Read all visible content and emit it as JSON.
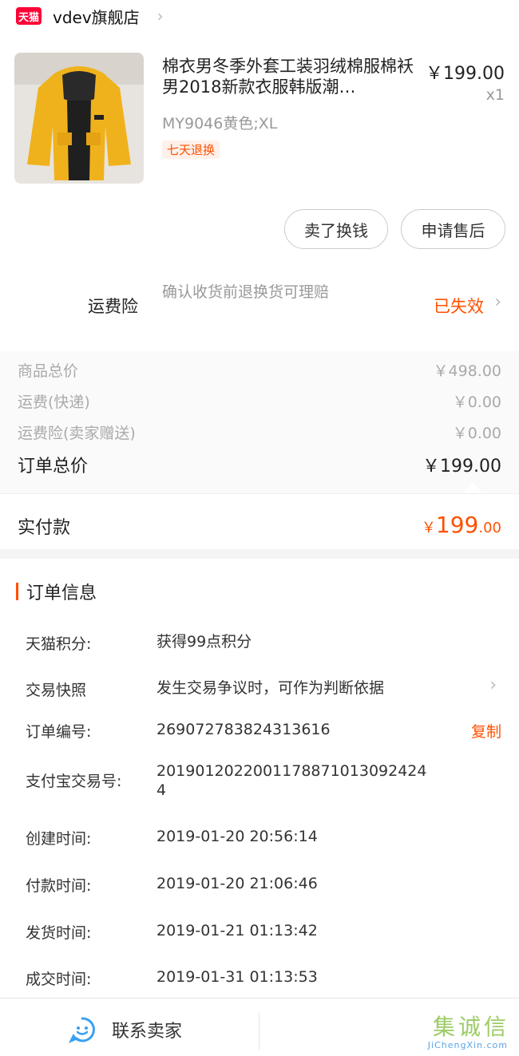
{
  "store": {
    "badge": "天猫",
    "name": "vdev旗舰店"
  },
  "product": {
    "title": "棉衣男冬季外套工装羽绒棉服棉袄男2018新款衣服韩版潮…",
    "price": "￥199.00",
    "qty": "x1",
    "sku": "MY9046黄色;XL",
    "tag": "七天退换"
  },
  "actions": {
    "sell": "卖了换钱",
    "aftersale": "申请售后"
  },
  "insurance": {
    "label": "运费险",
    "desc": "确认收货前退换货可理赔",
    "status": "已失效"
  },
  "prices": {
    "goods_label": "商品总价",
    "goods_value": "￥498.00",
    "shipping_label": "运费(快递)",
    "shipping_value": "￥0.00",
    "ins_label": "运费险(卖家赠送)",
    "ins_value": "￥0.00",
    "total_label": "订单总价",
    "total_value": "￥199.00"
  },
  "paid": {
    "label": "实付款",
    "currency": "￥",
    "integer": "199",
    "decimal": ".00"
  },
  "order_info": {
    "title": "订单信息",
    "points_key": "天猫积分:",
    "points_val": "获得99点积分",
    "snapshot_key": "交易快照",
    "snapshot_val": "发生交易争议时，可作为判断依据",
    "order_no_key": "订单编号:",
    "order_no_val": "269072783824313616",
    "copy": "复制",
    "alipay_key": "支付宝交易号:",
    "alipay_val": "20190120220011788710130924244",
    "created_key": "创建时间:",
    "created_val": "2019-01-20 20:56:14",
    "paid_key": "付款时间:",
    "paid_val": "2019-01-20 21:06:46",
    "shipped_key": "发货时间:",
    "shipped_val": "2019-01-21 01:13:42",
    "done_key": "成交时间:",
    "done_val": "2019-01-31 01:13:53"
  },
  "bottom": {
    "contact": "联系卖家"
  },
  "watermark": {
    "cn": "集诚信",
    "en": "JiChengXin.com"
  },
  "colors": {
    "accent": "#ff5000",
    "tmall_red": "#ff0036"
  }
}
